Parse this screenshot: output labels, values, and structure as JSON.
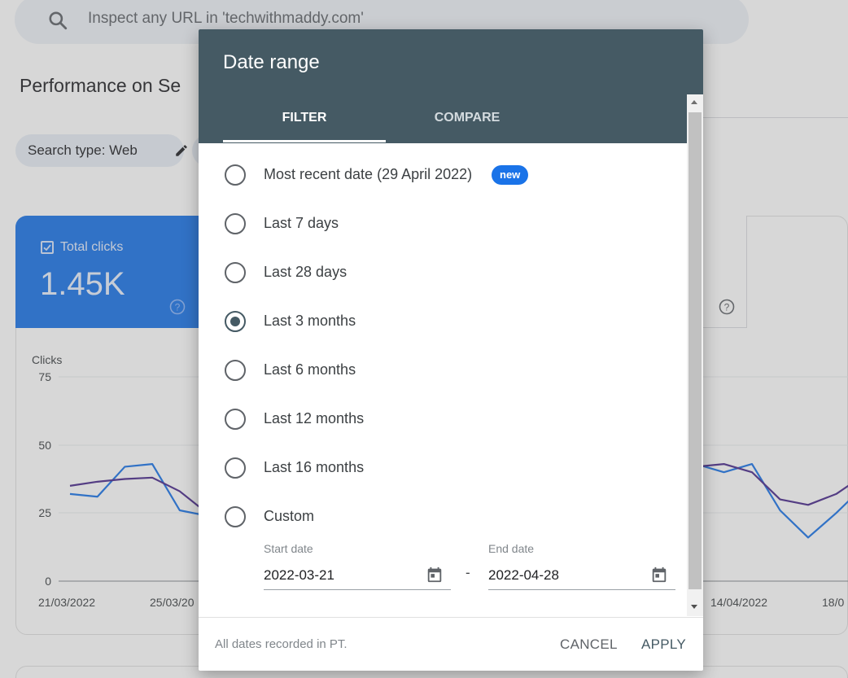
{
  "background": {
    "search": {
      "placeholder": "Inspect any URL in 'techwithmaddy.com'"
    },
    "page_title": "Performance on Se",
    "filter_chip": {
      "label": "Search type: Web"
    },
    "metric_card": {
      "label": "Total clicks",
      "value": "1.45K",
      "checked": true,
      "color": "#1a73e8"
    },
    "chart_data": {
      "type": "line",
      "ylabel": "Clicks",
      "ylim": [
        0,
        75
      ],
      "yticks": [
        "75",
        "50",
        "25",
        "0"
      ],
      "x_tick_labels": [
        "21/03/2022",
        "25/03/20",
        "14/04/2022",
        "18/0"
      ],
      "series": [
        {
          "color": "#1a73e8",
          "left_points": [
            [
              0,
              32
            ],
            [
              1,
              31
            ],
            [
              2,
              42
            ],
            [
              3,
              43
            ],
            [
              4,
              26
            ],
            [
              5,
              24
            ]
          ],
          "right_points": [
            [
              0,
              43
            ],
            [
              1,
              40
            ],
            [
              2,
              43
            ],
            [
              3,
              26
            ],
            [
              4,
              16
            ],
            [
              5,
              25
            ],
            [
              6,
              35
            ]
          ]
        },
        {
          "color": "#4a2a8c",
          "left_points": [
            [
              0,
              35
            ],
            [
              1,
              36.5
            ],
            [
              2,
              37.5
            ],
            [
              3,
              38
            ],
            [
              4,
              33
            ],
            [
              5,
              25
            ]
          ],
          "right_points": [
            [
              0,
              42
            ],
            [
              1,
              43
            ],
            [
              2,
              40
            ],
            [
              3,
              30
            ],
            [
              4,
              28
            ],
            [
              5,
              32
            ],
            [
              6,
              39
            ]
          ]
        }
      ]
    }
  },
  "dialog": {
    "title": "Date range",
    "tabs": [
      {
        "label": "FILTER",
        "active": true
      },
      {
        "label": "COMPARE",
        "active": false
      }
    ],
    "options": [
      {
        "label": "Most recent date (29 April 2022)",
        "badge": "new",
        "checked": false
      },
      {
        "label": "Last 7 days",
        "checked": false
      },
      {
        "label": "Last 28 days",
        "checked": false
      },
      {
        "label": "Last 3 months",
        "checked": true
      },
      {
        "label": "Last 6 months",
        "checked": false
      },
      {
        "label": "Last 12 months",
        "checked": false
      },
      {
        "label": "Last 16 months",
        "checked": false
      },
      {
        "label": "Custom",
        "checked": false
      }
    ],
    "custom": {
      "start_caption": "Start date",
      "start_value": "2022-03-21",
      "separator": "-",
      "end_caption": "End date",
      "end_value": "2022-04-28"
    },
    "footer_note": "All dates recorded in PT.",
    "cancel_label": "CANCEL",
    "apply_label": "APPLY"
  },
  "colors": {
    "header": "#455a64",
    "accent": "#1a73e8"
  }
}
